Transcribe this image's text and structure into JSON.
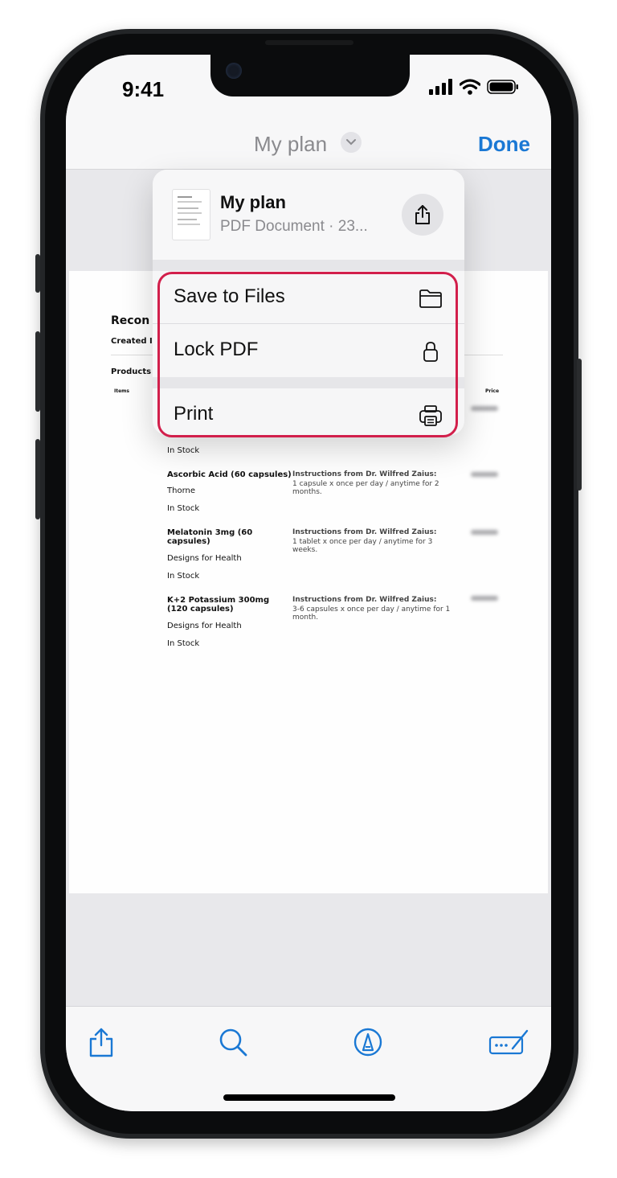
{
  "status_bar": {
    "time": "9:41"
  },
  "nav": {
    "title": "My plan",
    "done_label": "Done"
  },
  "menu": {
    "title": "My plan",
    "subtitle": "PDF Document · 23...",
    "items": [
      {
        "label": "Save to Files",
        "icon": "folder-icon"
      },
      {
        "label": "Lock PDF",
        "icon": "lock-icon"
      },
      {
        "label": "Print",
        "icon": "printer-icon"
      }
    ],
    "highlight_color": "#d21f4b"
  },
  "pdf": {
    "heading": "Recon",
    "created": "Created I",
    "products": "Products",
    "col_items": "Items",
    "col_price": "Price",
    "products_list": [
      {
        "name": "In Stock"
      },
      {
        "name": "Ascorbic Acid (60 capsules)",
        "brand": "Thorne",
        "stock": "In Stock",
        "instr_title": "Instructions from Dr. Wilfred Zaius:",
        "instr": "1 capsule x once per day / anytime for 2 months."
      },
      {
        "name": "Melatonin 3mg (60 capsules)",
        "brand": "Designs for Health",
        "stock": "In Stock",
        "instr_title": "Instructions from Dr. Wilfred Zaius:",
        "instr": "1 tablet x once per day / anytime for 3 weeks."
      },
      {
        "name": "K+2 Potassium 300mg (120 capsules)",
        "brand": "Designs for Health",
        "stock": "In Stock",
        "instr_title": "Instructions from Dr. Wilfred Zaius:",
        "instr": "3-6 capsules x once per day / anytime for 1 month."
      }
    ]
  },
  "toolbar": {
    "buttons": [
      "share-icon",
      "search-icon",
      "markup-icon",
      "signature-icon"
    ],
    "accent": "#1a78d4"
  }
}
